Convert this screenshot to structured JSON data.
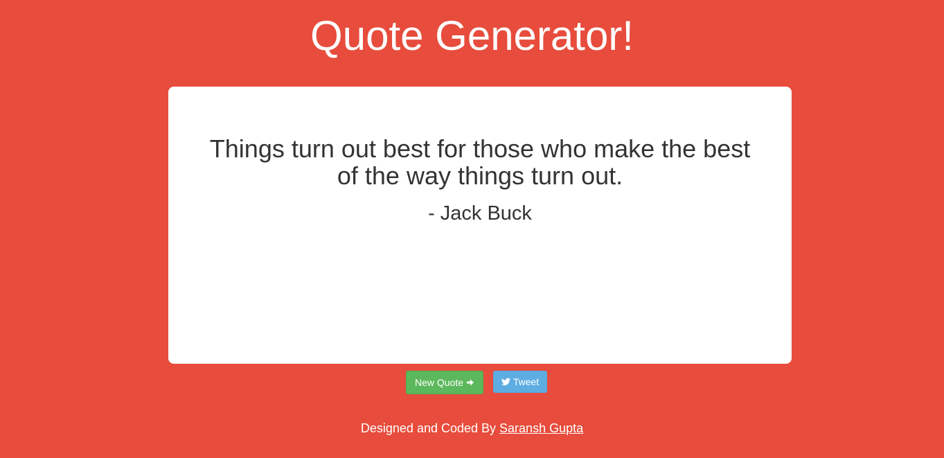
{
  "header": {
    "title": "Quote Generator!"
  },
  "quote": {
    "text": "Things turn out best for those who make the best of the way things turn out.",
    "author": "- Jack Buck"
  },
  "actions": {
    "new_quote_label": "New Quote",
    "new_quote_icon": "arrow-right-icon",
    "tweet_label": "Tweet",
    "tweet_icon": "twitter-icon"
  },
  "footer": {
    "prefix": "Designed and Coded By ",
    "author_link": "Saransh Gupta"
  },
  "colors": {
    "background": "#e74c3c",
    "card": "#ffffff",
    "new_quote_button": "#5cb85c",
    "tweet_button": "#5dade2",
    "quote_text": "#333333"
  }
}
